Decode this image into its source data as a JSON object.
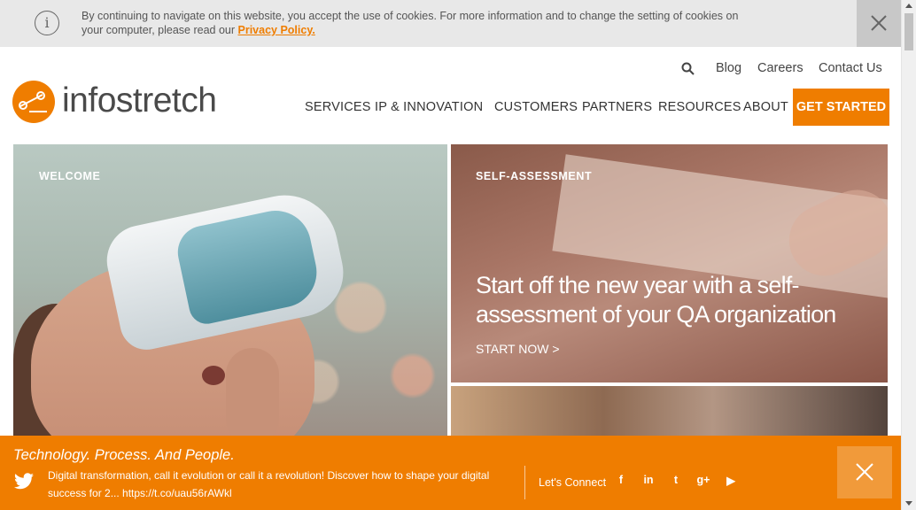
{
  "cookie_bar": {
    "text": "By continuing to navigate on this website, you accept the use of cookies. For more information and to change the setting of cookies on your computer, please read our ",
    "link": "Privacy Policy."
  },
  "header": {
    "logo_text": "infostretch",
    "utility_links": [
      "Blog",
      "Careers",
      "Contact Us"
    ],
    "nav": [
      "SERVICES",
      "IP & INNOVATION",
      "CUSTOMERS",
      "PARTNERS",
      "RESOURCES",
      "ABOUT"
    ],
    "cta": "GET STARTED"
  },
  "tiles": {
    "welcome": {
      "label": "WELCOME"
    },
    "self_assessment": {
      "label": "SELF-ASSESSMENT",
      "headline": "Start off the new year with a self-assessment of your QA organization",
      "cta": "START NOW >"
    }
  },
  "bottom_bar": {
    "tagline": "Technology. Process. And People.",
    "tweet": "Digital transformation, call it evolution or call it a revolution! Discover how to shape your digital success for 2... https://t.co/uau56rAWkl",
    "connect_label": "Let's Connect",
    "social_glyphs": [
      "f",
      "in",
      "t",
      "g+",
      "▶"
    ]
  },
  "colors": {
    "brand_orange": "#ef7d00",
    "cookie_bg": "#e8e8e8"
  },
  "icons": {
    "info": "info-icon",
    "close": "close-icon",
    "search": "search-icon",
    "twitter": "twitter-icon"
  }
}
